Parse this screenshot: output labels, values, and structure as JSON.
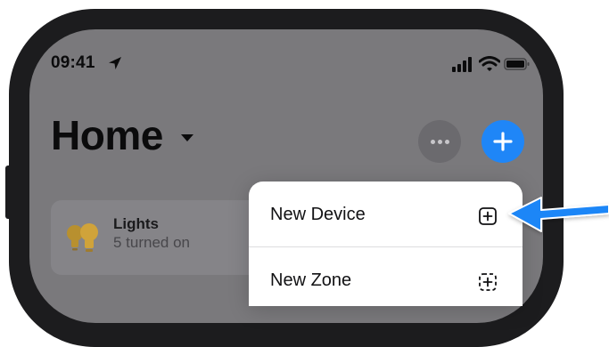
{
  "status_bar": {
    "time": "09:41",
    "icons": [
      "location-arrow-icon",
      "cellular-signal-icon",
      "wifi-icon",
      "battery-icon"
    ]
  },
  "header": {
    "title": "Home",
    "title_menu_icon": "chevron-down-icon",
    "more_icon": "ellipsis-icon",
    "add_icon": "plus-icon"
  },
  "cards": [
    {
      "title": "Lights",
      "subtitle": "5 turned on",
      "icon": "light-bulb-icon"
    }
  ],
  "context_menu": {
    "items": [
      {
        "label": "New Device",
        "icon": "plus-square-icon"
      },
      {
        "label": "New Zone",
        "icon": "plus-dashed-square-icon"
      }
    ]
  },
  "annotation": {
    "icon": "callout-arrow-icon",
    "color": "#1f86f7"
  },
  "colors": {
    "accent": "#1f86f7",
    "dimmed_background": "#7a797c",
    "menu_background": "#ffffff",
    "bulb": "#b8902f"
  }
}
